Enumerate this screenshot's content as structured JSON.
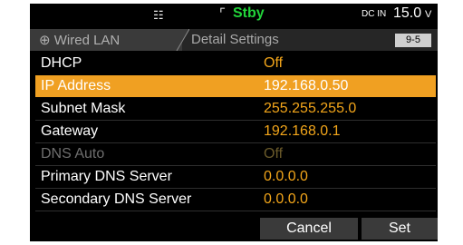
{
  "status": {
    "network_icon": "network-icon",
    "standby_icon": "standby-icon",
    "standby_text": "Stby",
    "power_label": "DC IN",
    "power_value": "15.0",
    "power_unit": "V"
  },
  "header": {
    "tab_label": "Wired LAN",
    "tab_icon": "globe-icon",
    "subtitle": "Detail Settings",
    "page": "9-5"
  },
  "rows": [
    {
      "label": "DHCP",
      "value": "Off",
      "state": "normal"
    },
    {
      "label": "IP Address",
      "value": "192.168.0.50",
      "state": "selected"
    },
    {
      "label": "Subnet Mask",
      "value": "255.255.255.0",
      "state": "normal"
    },
    {
      "label": "Gateway",
      "value": "192.168.0.1",
      "state": "normal"
    },
    {
      "label": "DNS Auto",
      "value": "Off",
      "state": "disabled"
    },
    {
      "label": "Primary DNS Server",
      "value": "0.0.0.0",
      "state": "normal"
    },
    {
      "label": "Secondary DNS Server",
      "value": "0.0.0.0",
      "state": "normal"
    }
  ],
  "buttons": {
    "cancel": "Cancel",
    "set": "Set"
  },
  "colors": {
    "accent": "#f0a022",
    "value_text": "#f2a51a",
    "standby_green": "#22d43a",
    "background": "#000000"
  }
}
